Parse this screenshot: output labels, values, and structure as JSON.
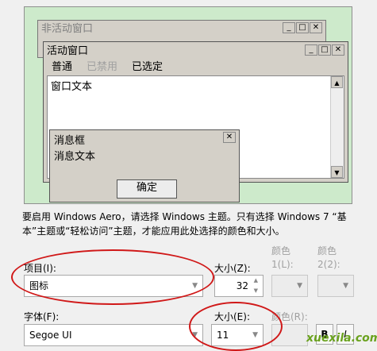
{
  "preview": {
    "inactive_window_title": "非活动窗口",
    "active_window_title": "活动窗口",
    "menu": {
      "normal": "普通",
      "disabled": "已禁用",
      "selected": "已选定"
    },
    "window_text": "窗口文本",
    "message_box": {
      "title": "消息框",
      "text": "消息文本",
      "ok_label": "确定"
    },
    "sysbtns": {
      "min": "_",
      "max": "□",
      "close": "✕"
    }
  },
  "description": "要启用 Windows Aero，请选择 Windows 主题。只有选择 Windows 7 “基本”主题或“轻松访问”主题，才能应用此处选择的颜色和大小。",
  "item": {
    "label": "项目(I):",
    "value": "图标",
    "size_label": "大小(Z):",
    "size_value": "32",
    "color1_label": "颜色 1(L):",
    "color2_label": "颜色 2(2):"
  },
  "font": {
    "label": "字体(F):",
    "value": "Segoe UI",
    "size_label": "大小(E):",
    "size_value": "11",
    "color_label": "颜色(R):",
    "bold_label": "B",
    "italic_label": "I"
  },
  "watermark": "xuexila.com",
  "colors": {
    "annotation_red": "#d01818",
    "preview_bg": "#cdeacb"
  }
}
